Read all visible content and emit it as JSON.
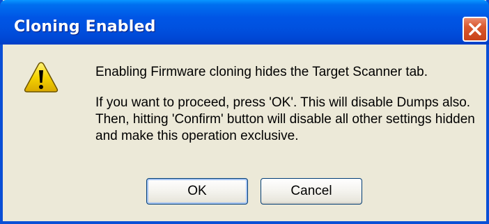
{
  "dialog": {
    "title": "Cloning Enabled",
    "icon": "warning-icon",
    "message_line1": "Enabling Firmware cloning hides the Target Scanner tab.",
    "message_line2": "If you want to proceed, press 'OK'. This will disable Dumps also. Then, hitting 'Confirm' button will disable all other settings hidden and make this operation exclusive.",
    "ok_label": "OK",
    "cancel_label": "Cancel"
  },
  "colors": {
    "titlebar": "#0055e5",
    "close_button": "#d9582e",
    "window_background": "#ece9d8",
    "warning_fill": "#f5d400"
  }
}
